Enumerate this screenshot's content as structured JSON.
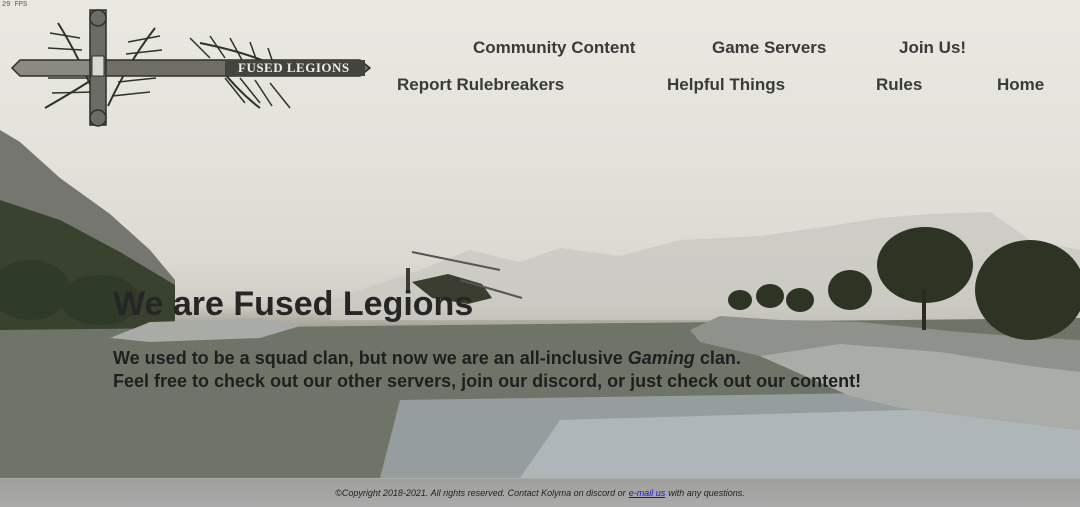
{
  "fps": "29 FPS",
  "logo": {
    "text": "FUSED LEGIONS"
  },
  "nav": {
    "community_content": "Community Content",
    "game_servers": "Game Servers",
    "join_us": "Join Us!",
    "report_rulebreakers": "Report Rulebreakers",
    "helpful_things": "Helpful Things",
    "rules": "Rules",
    "home": "Home"
  },
  "hero": {
    "title": "We are Fused Legions",
    "line1_before": "We used to be a squad clan, but now we are an all-inclusive ",
    "line1_emph": "Gaming",
    "line1_after": " clan.",
    "line2": "Feel free to check out our other servers, join our discord, or just check out our content!"
  },
  "footer": {
    "before": "©Copyright 2018-2021. All rights reserved. Contact Kolyma on discord or",
    "link": "e-mail us",
    "after": "with any questions."
  },
  "colors": {
    "nav_text": "#3a3a3a",
    "hero_text": "#262626",
    "footer_link": "#1313e0"
  }
}
